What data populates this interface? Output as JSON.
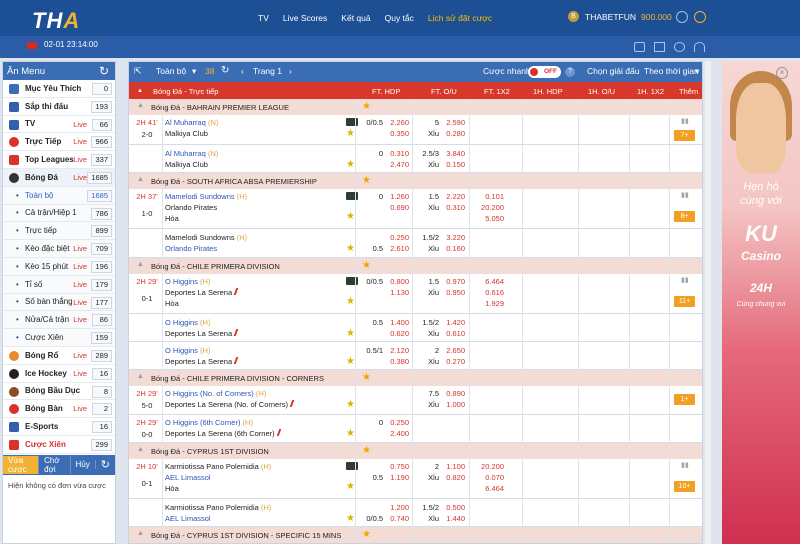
{
  "header": {
    "logo_main": "TH",
    "logo_accent": "A",
    "nav": [
      "TV",
      "Live Scores",
      "Kết quả",
      "Quy tắc",
      "Lịch sử đặt cược"
    ],
    "coin": "B",
    "username": "THABETFUN",
    "balance": "900.000"
  },
  "subheader": {
    "datetime": "02-01 23:14:00"
  },
  "sidebar": {
    "title": "Ăn Menu",
    "items": [
      {
        "label": "Mục Yêu Thích",
        "count": "0",
        "live": ""
      },
      {
        "label": "Sắp thi đấu",
        "count": "193",
        "live": ""
      },
      {
        "label": "TV",
        "count": "66",
        "live": "Live"
      },
      {
        "label": "Trực Tiếp",
        "count": "966",
        "live": "Live"
      },
      {
        "label": "Top Leagues",
        "count": "337",
        "live": "Live"
      },
      {
        "label": "Bóng Đá",
        "count": "1685",
        "live": "Live"
      },
      {
        "label": "Toàn bộ",
        "count": "1685",
        "live": ""
      },
      {
        "label": "Cả trận/Hiệp 1",
        "count": "786",
        "live": ""
      },
      {
        "label": "Trực tiếp",
        "count": "899",
        "live": ""
      },
      {
        "label": "Kèo đặc biệt",
        "count": "709",
        "live": "Live"
      },
      {
        "label": "Kèo 15 phút",
        "count": "196",
        "live": "Live"
      },
      {
        "label": "Tỉ số",
        "count": "179",
        "live": "Live"
      },
      {
        "label": "Số bàn thắng",
        "count": "177",
        "live": "Live"
      },
      {
        "label": "Nửa/Cả trận",
        "count": "86",
        "live": "Live"
      },
      {
        "label": "Cược Xiên",
        "count": "159",
        "live": ""
      },
      {
        "label": "Bóng Rổ",
        "count": "289",
        "live": "Live"
      },
      {
        "label": "Ice Hockey",
        "count": "16",
        "live": "Live"
      },
      {
        "label": "Bóng Bầu Dục",
        "count": "8",
        "live": ""
      },
      {
        "label": "Bóng Bàn",
        "count": "2",
        "live": "Live"
      },
      {
        "label": "E-Sports",
        "count": "16",
        "live": ""
      },
      {
        "label": "Cược Xiên",
        "count": "299",
        "live": ""
      }
    ],
    "slip_tabs": [
      "Vừa cược",
      "Chờ đợi",
      "Hủy"
    ],
    "slip_empty": "Hiện không có đơn vừa cược"
  },
  "toolbar": {
    "all": "Toàn bộ",
    "count": "38",
    "page": "Trang 1",
    "quick_bet": "Cược nhanh",
    "toggle": "OFF",
    "help": "?",
    "choose_league": "Chọn giải đấu",
    "by_time": "Theo thời gian"
  },
  "columns": {
    "section": "Bóng Đá - Trực tiếp",
    "ft_hdp": "FT. HDP",
    "ft_ou": "FT. O/U",
    "ft_1x2": "FT. 1X2",
    "h1_hdp": "1H. HDP",
    "h1_ou": "1H. O/U",
    "h1_1x2": "1H. 1X2",
    "more": "Thêm"
  },
  "leagues": [
    {
      "name": "Bóng Đá - BAHRAIN PREMIER LEAGUE"
    },
    {
      "name": "Bóng Đá - SOUTH AFRICA ABSA PREMIERSHIP"
    },
    {
      "name": "Bóng Đá - CHILE PRIMERA DIVISION"
    },
    {
      "name": "Bóng Đá - CHILE PRIMERA DIVISION - CORNERS"
    },
    {
      "name": "Bóng Đá - CYPRUS 1ST DIVISION"
    },
    {
      "name": "Bóng Đá - CYPRUS 1ST DIVISION - SPECIFIC 15 MINS"
    }
  ],
  "matches": {
    "m1": {
      "time": "2H 41'",
      "score": "2-0",
      "home": "Al Muharraq",
      "hmark": "(N)",
      "away": "Malkiya Club",
      "hdp": "0/0.5",
      "hdp_h": "2.260",
      "hdp_a": "0.350",
      "ou": "5",
      "ou_h": "2.590",
      "xiu": "Xỉu",
      "ou_a": "0.280",
      "more": "7+"
    },
    "m1b": {
      "home": "Al Muharraq",
      "hmark": "(N)",
      "away": "Malkiya Club",
      "hdp": "0",
      "hdp_h": "0.310",
      "hdp_a": "2.470",
      "ou": "2.5/3",
      "ou_h": "3.840",
      "xiu": "Xỉu",
      "ou_a": "0.150"
    },
    "m2": {
      "time": "2H 37'",
      "score": "1-0",
      "home": "Mamelodi Sundowns",
      "hmark": "(H)",
      "away": "Orlando Pirates",
      "draw": "Hòa",
      "hdp": "0",
      "hdp_h": "1.260",
      "hdp_a": "0.690",
      "ou": "1.5",
      "ou_h": "2.220",
      "xiu": "Xỉu",
      "ou_a": "0.310",
      "x1": "0.101",
      "x2": "20.200",
      "x3": "5.050",
      "more": "8+"
    },
    "m2b": {
      "home": "Mamelodi Sundowns",
      "hmark": "(H)",
      "away": "Orlando Pirates",
      "hdp_h": "0.250",
      "hdp_pre": "0.5",
      "hdp_a": "2.610",
      "ou": "1.5/2",
      "ou_h": "3.220",
      "xiu": "Xỉu",
      "ou_a": "0.160"
    },
    "m3": {
      "time": "2H 29'",
      "score": "0-1",
      "home": "O Higgins",
      "hmark": "(H)",
      "away": "Deportes La Serena",
      "draw": "Hòa",
      "hdp": "0/0.5",
      "hdp_h": "0.800",
      "hdp_a": "1.130",
      "ou": "1.5",
      "ou_h": "0.970",
      "xiu": "Xỉu",
      "ou_a": "0.950",
      "x1": "6.464",
      "x2": "0.616",
      "x3": "1.929",
      "more": "11+"
    },
    "m3b": {
      "home": "O Higgins",
      "hmark": "(H)",
      "away": "Deportes La Serena",
      "hdp": "0.5",
      "hdp_h": "1.400",
      "hdp_a": "0.620",
      "ou": "1.5/2",
      "ou_h": "1.420",
      "xiu": "Xỉu",
      "ou_a": "0.610"
    },
    "m3c": {
      "home": "O Higgins",
      "hmark": "(H)",
      "away": "Deportes La Serena",
      "hdp": "0.5/1",
      "hdp_h": "2.120",
      "hdp_a": "0.380",
      "ou": "2",
      "ou_h": "2.650",
      "xiu": "Xỉu",
      "ou_a": "0.270"
    },
    "m4": {
      "time": "2H 29'",
      "score": "5-0",
      "home": "O Higgins (No. of Corners)",
      "hmark": "(H)",
      "away": "Deportes La Serena (No. of Corners)",
      "ou": "7.5",
      "ou_h": "0.890",
      "xiu": "Xỉu",
      "ou_a": "1.000",
      "more": "1+"
    },
    "m4b": {
      "time": "2H 29'",
      "score": "0-0",
      "home": "O Higgins (6th Corner)",
      "hmark": "(H)",
      "away": "Deportes La Serena (6th Corner)",
      "hdp": "0",
      "hdp_h": "0.250",
      "hdp_a": "2.400"
    },
    "m5": {
      "time": "2H 10'",
      "score": "0-1",
      "home": "Karmiotissa Pano Polemidia",
      "hmark": "(H)",
      "away": "AEL Limassol",
      "draw": "Hòa",
      "hdp_h": "0.750",
      "hdp_pre": "0.5",
      "hdp_a": "1.190",
      "ou": "2",
      "ou_h": "1.100",
      "xiu": "Xỉu",
      "ou_a": "0.820",
      "x1": "20.200",
      "x2": "0.070",
      "x3": "6.464",
      "more": "10+"
    },
    "m5b": {
      "home": "Karmiotissa Pano Polemidia",
      "hmark": "(H)",
      "away": "AEL Limassol",
      "hdp_h": "1.200",
      "hdp_pre": "0/0.5",
      "hdp_a": "0.740",
      "ou": "1.5/2",
      "ou_h": "0.500",
      "xiu": "Xỉu",
      "ou_a": "1.440"
    }
  },
  "ad": {
    "line1": "Hẹn hò",
    "line2": "cùng với",
    "brand": "KU",
    "brand2": "Casino",
    "badge": "24H",
    "tagline": "Cùng chung vui"
  },
  "colors": {
    "primary": "#1d4f94",
    "header_red": "#d8382c",
    "accent": "#f2a023",
    "live": "#d8322b"
  }
}
